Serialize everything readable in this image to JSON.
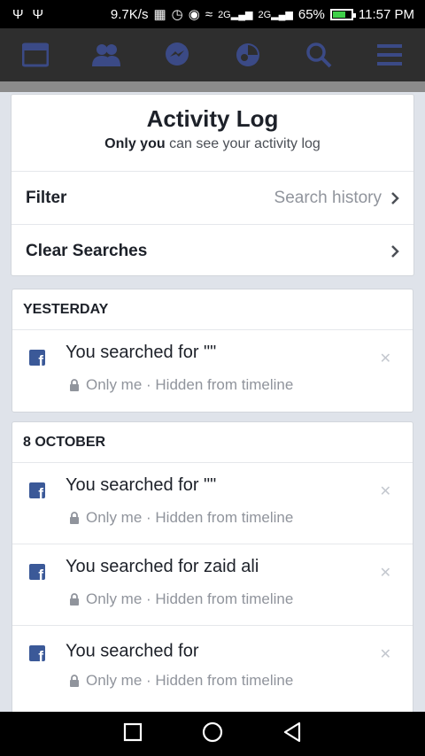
{
  "status_bar": {
    "left_icons": [
      "usb-icon",
      "usb-icon"
    ],
    "speed": "9.7K/s",
    "signal_labels": [
      "2G",
      "2G"
    ],
    "battery": "65%",
    "time": "11:57 PM"
  },
  "nav": {
    "items": [
      "news-feed-icon",
      "friends-icon",
      "messenger-icon",
      "notifications-icon",
      "search-icon",
      "menu-icon"
    ]
  },
  "header": {
    "title": "Activity Log",
    "subtitle_bold": "Only you",
    "subtitle_rest": " can see your activity log"
  },
  "filter": {
    "label": "Filter",
    "value": "Search history"
  },
  "clear": {
    "label": "Clear Searches"
  },
  "sections": [
    {
      "title": "YESTERDAY",
      "entries": [
        {
          "text": "You searched for \"\"",
          "meta": "Only me · Hidden from timeline"
        }
      ]
    },
    {
      "title": "8 OCTOBER",
      "entries": [
        {
          "text": "You searched for \"\"",
          "meta": "Only me · Hidden from timeline"
        },
        {
          "text": "You searched for zaid ali",
          "meta": "Only me · Hidden from timeline"
        },
        {
          "text": "You searched for",
          "meta": "Only me · Hidden from timeline"
        }
      ]
    }
  ],
  "colors": {
    "fb_blue": "#3b5998",
    "nav_icon": "#3b4a86",
    "nav_bar": "#2e2e2e"
  }
}
